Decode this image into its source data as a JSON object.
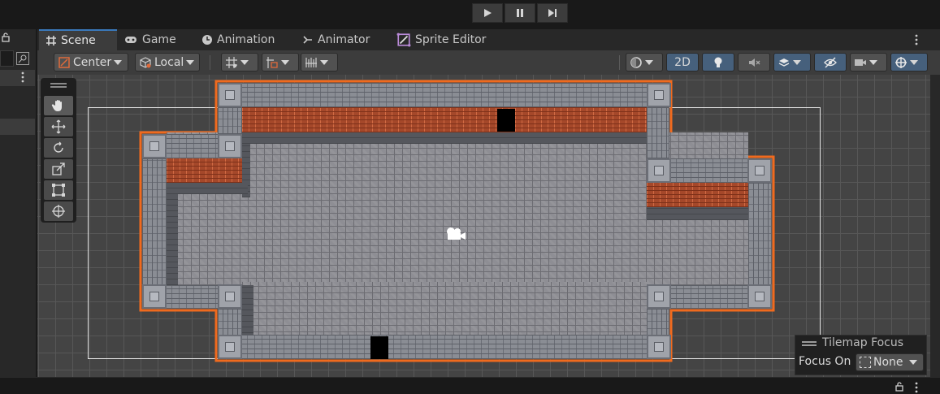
{
  "tabs": [
    {
      "label": "Scene",
      "icon": "grid-icon",
      "active": true
    },
    {
      "label": "Game",
      "icon": "gamepad-icon",
      "active": false
    },
    {
      "label": "Animation",
      "icon": "clock-icon",
      "active": false
    },
    {
      "label": "Animator",
      "icon": "animator-icon",
      "active": false
    },
    {
      "label": "Sprite Editor",
      "icon": "sprite-editor-icon",
      "active": false
    }
  ],
  "toolbar": {
    "pivot_label": "Center",
    "space_label": "Local",
    "mode_2d_label": "2D"
  },
  "tilemap_focus": {
    "title": "Tilemap Focus",
    "focus_on_label": "Focus On",
    "focus_value": "None"
  },
  "colors": {
    "accent": "#3a79bb",
    "selection_outline": "#f06a1e",
    "scene_bg": "#444444",
    "brick": "#a5482a"
  }
}
